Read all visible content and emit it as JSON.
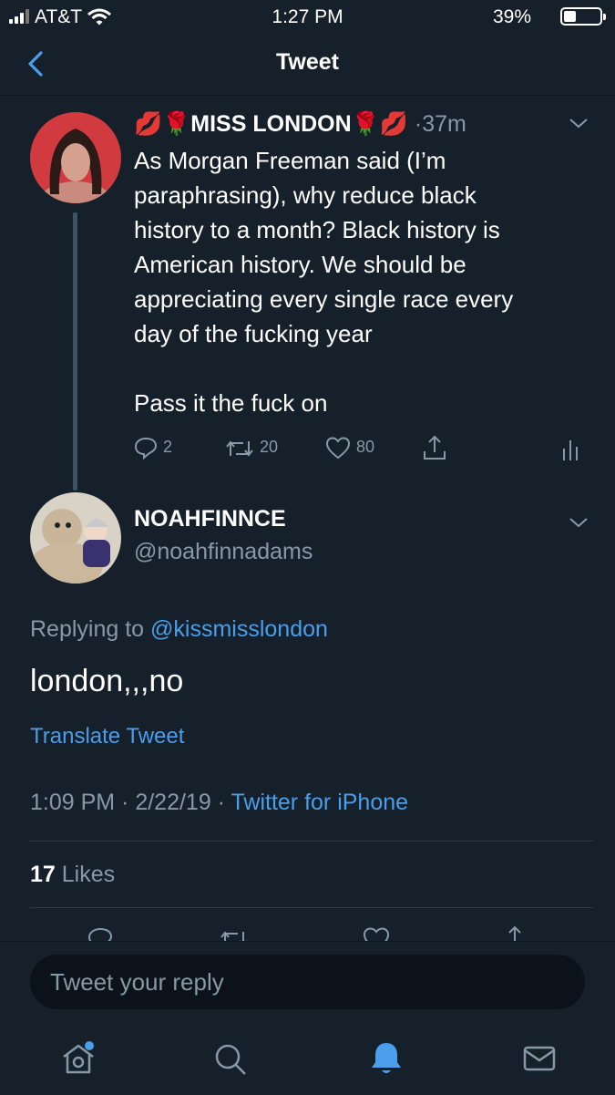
{
  "status_bar": {
    "carrier": "AT&T",
    "time": "1:27 PM",
    "battery": "39%",
    "battery_level": 0.39
  },
  "header": {
    "title": "Tweet"
  },
  "parent_tweet": {
    "display_name": "💋🌹MISS LONDON🌹💋",
    "name_text": "MISS LONDON",
    "time_ago": "·37m",
    "text": "As Morgan Freeman said (I’m\nparaphrasing), why reduce black\nhistory to a month? Black history is\nAmerican history. We should be\nappreciating every single race every\nday of the fucking year\n\nPass it the fuck on",
    "replies": "2",
    "retweets": "20",
    "likes": "80"
  },
  "main_tweet": {
    "display_name": "NOAHFINNCE",
    "handle": "@noahfinnadams",
    "replying_prefix": "Replying to",
    "replying_to": "@kissmisslondon",
    "text": "london,,,no",
    "translate": "Translate Tweet",
    "timestamp": "1:09 PM · 2/22/19 ·",
    "source": "Twitter for iPhone",
    "likes_count": "17",
    "likes_label": "Likes"
  },
  "reply_bar": {
    "placeholder": "Tweet your reply"
  },
  "colors": {
    "background": "#15202b",
    "accent": "#4a9eea",
    "secondary_text": "#8899a6",
    "divider": "#2f3a44"
  }
}
